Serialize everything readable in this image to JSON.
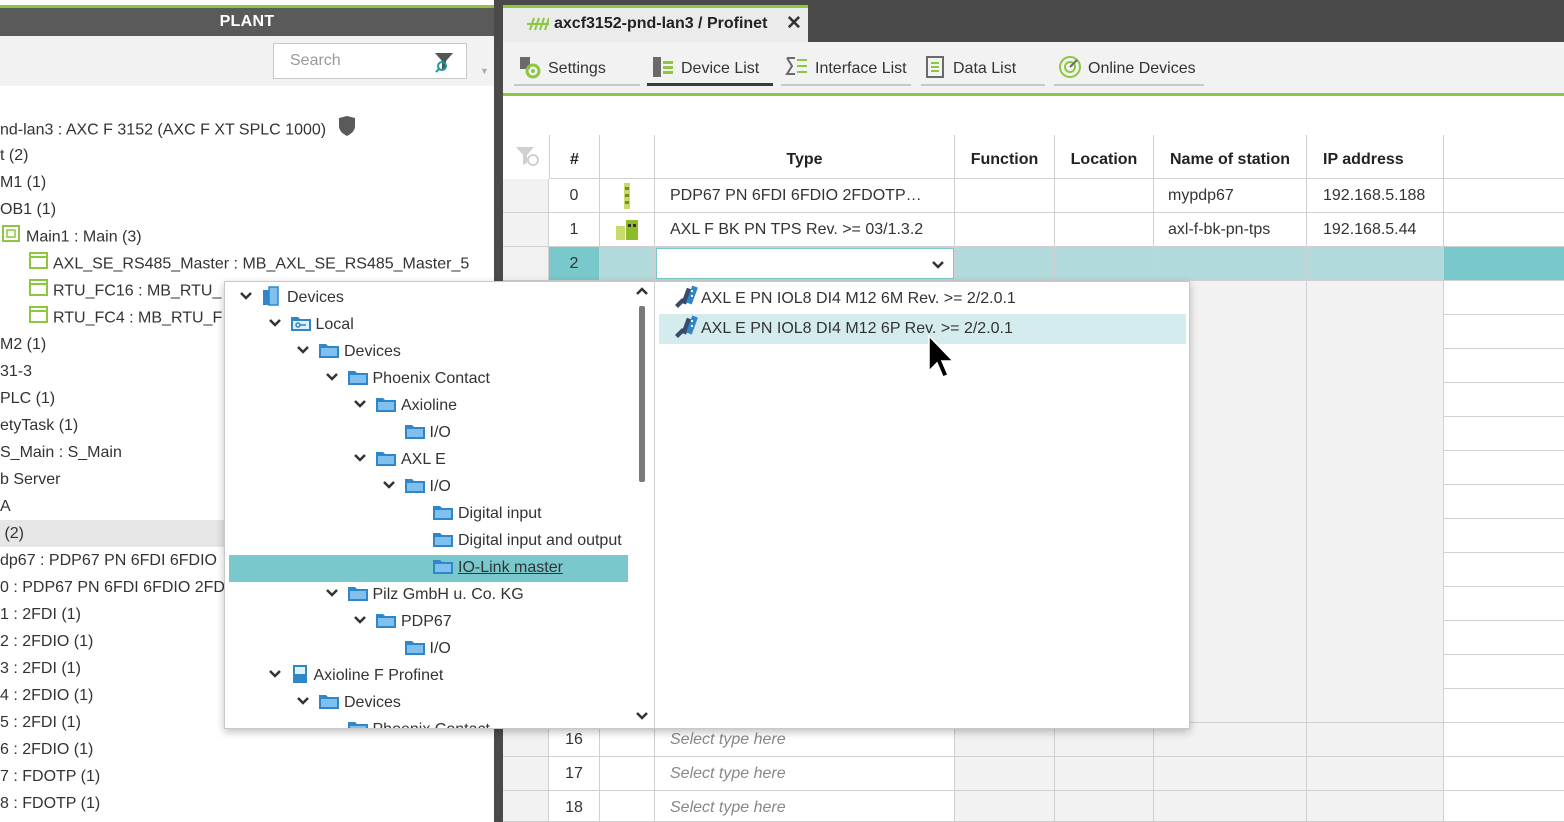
{
  "colors": {
    "accent": "#8dc63f",
    "dark_bar": "#4a4a4a",
    "selection": "#79c8cb",
    "row_selected": "#b2dadc",
    "hover": "#d4ecee"
  },
  "plant": {
    "title": "PLANT",
    "search_placeholder": "Search",
    "tree": [
      "nd-lan3 : AXC F 3152 (AXC F XT SPLC 1000)",
      "t (2)",
      "M1 (1)",
      "OB1 (1)",
      "Main1 : Main (3)",
      "AXL_SE_RS485_Master : MB_AXL_SE_RS485_Master_5",
      "RTU_FC16 : MB_RTU_",
      "RTU_FC4 : MB_RTU_F",
      "M2 (1)",
      "31-3",
      "PLC (1)",
      "etyTask (1)",
      "S_Main : S_Main",
      "b Server",
      "A",
      " (2)",
      "dp67 : PDP67 PN 6FDI 6FDIO",
      "0 : PDP67 PN 6FDI 6FDIO 2FD",
      "1 : 2FDI (1)",
      "2 : 2FDIO (1)",
      "3 : 2FDI (1)",
      "4 : 2FDIO (1)",
      "5 : 2FDI (1)",
      "6 : 2FDIO (1)",
      "7 : FDOTP (1)",
      "8 : FDOTP (1)"
    ]
  },
  "editor": {
    "tab_title": "axcf3152-pnd-lan3 / Profinet",
    "close_glyph": "✕",
    "subtabs": [
      "Settings",
      "Device List",
      "Interface List",
      "Data List",
      "Online Devices"
    ],
    "columns": [
      "#",
      "",
      "Type",
      "Function",
      "Location",
      "Name of station",
      "IP address"
    ],
    "rows": [
      {
        "num": "0",
        "type": "PDP67 PN 6FDI 6FDIO 2FDOTP…",
        "station": "mypdp67",
        "ip": "192.168.5.188"
      },
      {
        "num": "1",
        "type": "AXL F BK PN TPS Rev. >= 03/1.3.2",
        "station": "axl-f-bk-pn-tps",
        "ip": "192.168.5.44"
      },
      {
        "num": "2",
        "type": "",
        "station": "",
        "ip": ""
      }
    ],
    "bottom_rows": [
      {
        "num": "16",
        "type": "Select type here"
      },
      {
        "num": "17",
        "type": "Select type here"
      },
      {
        "num": "18",
        "type": "Select type here"
      }
    ]
  },
  "popup": {
    "tree": [
      {
        "label": "Devices",
        "level": 0,
        "icon": "device-group-icon",
        "chevron": "down"
      },
      {
        "label": "Local",
        "level": 1,
        "icon": "local-folder-icon",
        "chevron": "down"
      },
      {
        "label": "Devices",
        "level": 2,
        "icon": "folder-icon",
        "chevron": "down"
      },
      {
        "label": "Phoenix Contact",
        "level": 3,
        "icon": "folder-icon",
        "chevron": "down"
      },
      {
        "label": "Axioline",
        "level": 4,
        "icon": "folder-icon",
        "chevron": "down"
      },
      {
        "label": "I/O",
        "level": 5,
        "icon": "folder-icon",
        "chevron": ""
      },
      {
        "label": "AXL E",
        "level": 4,
        "icon": "folder-icon",
        "chevron": "down"
      },
      {
        "label": "I/O",
        "level": 5,
        "icon": "folder-icon",
        "chevron": "down"
      },
      {
        "label": "Digital input",
        "level": 6,
        "icon": "folder-icon",
        "chevron": ""
      },
      {
        "label": "Digital input and output",
        "level": 6,
        "icon": "folder-icon",
        "chevron": ""
      },
      {
        "label": "IO-Link master",
        "level": 6,
        "icon": "folder-icon",
        "chevron": "",
        "selected": true
      },
      {
        "label": "Pilz GmbH u. Co. KG",
        "level": 3,
        "icon": "folder-icon",
        "chevron": "down"
      },
      {
        "label": "PDP67",
        "level": 4,
        "icon": "folder-icon",
        "chevron": "down"
      },
      {
        "label": "I/O",
        "level": 5,
        "icon": "folder-icon",
        "chevron": ""
      },
      {
        "label": "Axioline F Profinet",
        "level": 1,
        "icon": "catalog-book-icon",
        "chevron": "down"
      },
      {
        "label": "Devices",
        "level": 2,
        "icon": "folder-icon",
        "chevron": "down"
      },
      {
        "label": "Phoenix Contact",
        "level": 3,
        "icon": "folder-icon",
        "chevron": ""
      }
    ],
    "list": [
      {
        "label": "AXL E PN IOL8 DI4 M12 6M Rev. >= 2/2.0.1",
        "hover": false
      },
      {
        "label": "AXL E PN IOL8 DI4 M12 6P Rev. >= 2/2.0.1",
        "hover": true
      }
    ]
  }
}
